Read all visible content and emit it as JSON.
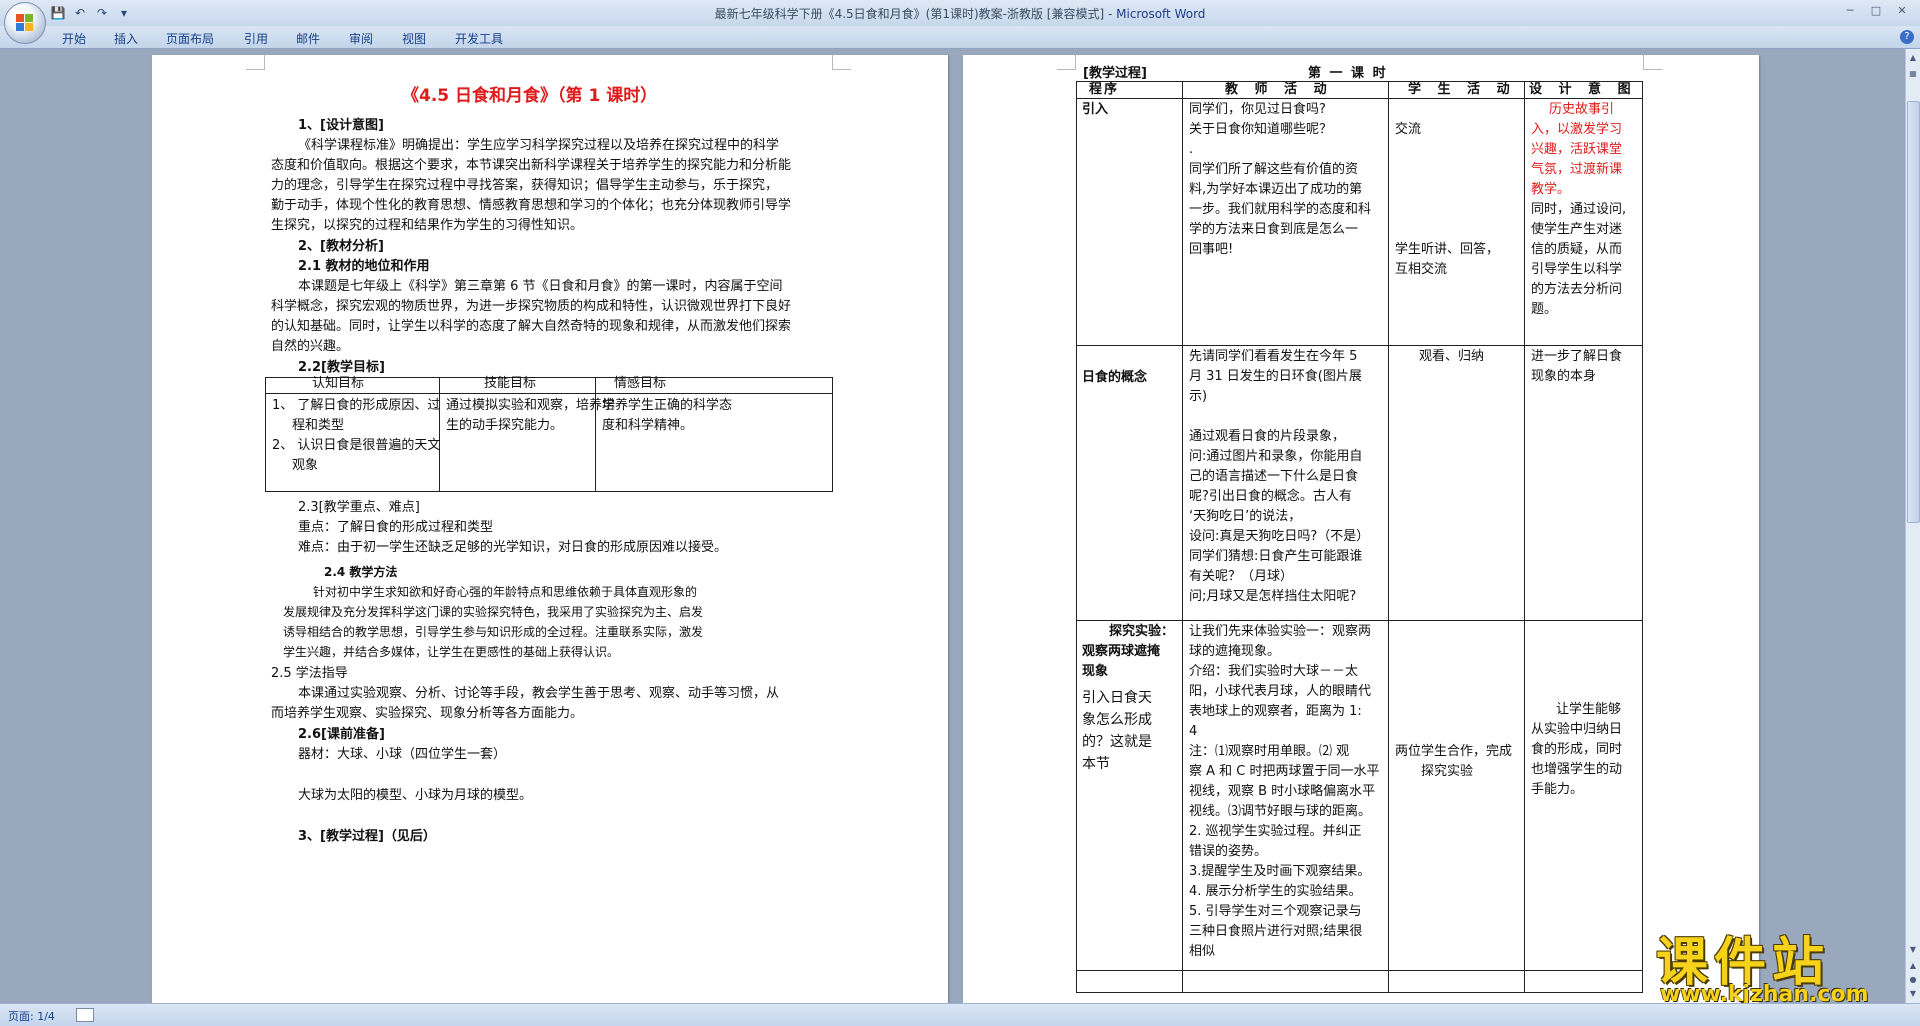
{
  "window": {
    "title_doc": "最新七年级科学下册《4.5日食和月食》(第1课时)教案-浙教版 [兼容模式] - ",
    "title_app": "Microsoft Word"
  },
  "qat": {
    "save": "save-icon",
    "undo": "undo-icon",
    "redo": "redo-icon",
    "more": "▾"
  },
  "ribbon": {
    "tabs": [
      "开始",
      "插入",
      "页面布局",
      "引用",
      "邮件",
      "审阅",
      "视图",
      "开发工具"
    ]
  },
  "status": {
    "page": "页面: 1/4"
  },
  "watermark": {
    "brand": "课件站",
    "url": "www.kjzhan.com"
  },
  "page1": {
    "title": "《4.5 日食和月食》（第 1 课时）",
    "s1_head": "1、[设计意图]",
    "s1_lines": [
      "《科学课程标准》明确提出：学生应学习科学探究过程以及培养在探究过程中的科学",
      "态度和价值取向。根据这个要求，本节课突出新科学课程关于培养学生的探究能力和分析能",
      "力的理念，引导学生在探究过程中寻找答案，获得知识；倡导学生主动参与，乐于探究，",
      "勤于动手，体现个性化的教育思想、情感教育思想和学习的个体化；也充分体现教师引导学",
      "生探究，以探究的过程和结果作为学生的习得性知识。"
    ],
    "s2_head": "2、[教材分析]",
    "s21_head": "2.1 教材的地位和作用",
    "s21_lines": [
      "本课题是七年级上《科学》第三章第 6 节《日食和月食》的第一课时，内容属于空间",
      "科学概念，探究宏观的物质世界，为进一步探究物质的构成和特性，认识微观世界打下良好",
      "的认知基础。同时，让学生以科学的态度了解大自然奇特的现象和规律，从而激发他们探索",
      "自然的兴趣。"
    ],
    "s22_head": "2.2[教学目标]",
    "goals_headers": [
      "认知目标",
      "技能目标",
      "情感目标"
    ],
    "goals_col1": [
      "1、    了解日食的形成原因、过",
      "程和类型",
      "2、    认识日食是很普遍的天文",
      "观象"
    ],
    "goals_col2": [
      "通过模拟实验和观察，培养学",
      "生的动手探究能力。"
    ],
    "goals_col3": [
      "培养学生正确的科学态",
      "度和科学精神。"
    ],
    "s23_head": "2.3[教学重点、难点]",
    "s23_key": "重点：了解日食的形成过程和类型",
    "s23_diff": "难点：由于初一学生还缺乏足够的光学知识，对日食的形成原因难以接受。",
    "s24_head": "2.4 教学方法",
    "s24_lines": [
      "针对初中学生求知欲和好奇心强的年龄特点和思维依赖于具体直观形象的",
      "发展规律及充分发挥科学这门课的实验探究特色，我采用了实验探究为主、启发",
      "诱导相结合的教学思想，引导学生参与知识形成的全过程。注重联系实际，激发",
      "学生兴趣，并结合多媒体，让学生在更感性的基础上获得认识。"
    ],
    "s25_head": "2.5 学法指导",
    "s25_lines": [
      "本课通过实验观察、分析、讨论等手段，教会学生善于思考、观察、动手等习惯，从",
      "而培养学生观察、实验探究、现象分析等各方面能力。"
    ],
    "s26_head": "2.6[课前准备]",
    "s26_tools": "器材：大球、小球（四位学生一套）",
    "s26_model": "大球为太阳的模型、小球为月球的模型。",
    "s3_head": "3、[教学过程]（见后）"
  },
  "page2": {
    "section_label": "[教学过程]",
    "lesson_label": "第 一 课 时",
    "headers": [
      "程序",
      "教 师 活 动",
      "学 生 活 动",
      "设 计 意 图"
    ],
    "row1": {
      "step": "引入",
      "teacher": [
        "同学们，你见过日食吗?",
        "关于日食你知道哪些呢？",
        ".",
        "同学们所了解这些有价值的资",
        "料,为学好本课迈出了成功的第",
        "一步。我们就用科学的态度和科",
        "学的方法来日食到底是怎么一",
        "回事吧!"
      ],
      "student": [
        "交流",
        "学生听讲、回答，",
        "互相交流"
      ],
      "design_red": [
        "历史故事引",
        "入，以激发学习",
        "兴趣，活跃课堂",
        "气氛，过渡新课",
        "教学。"
      ],
      "design": [
        "同时，通过设问,",
        "使学生产生对迷",
        "信的质疑，从而",
        "引导学生以科学",
        "的方法去分析问",
        "题。"
      ]
    },
    "row2": {
      "step": "日食的概念",
      "teacher": [
        "先请同学们看看发生在今年 5",
        "月 31 日发生的日环食(图片展",
        "示)",
        "通过观看日食的片段录象，",
        "问:通过图片和录象，你能用自",
        "己的语言描述一下什么是日食",
        "呢?引出日食的概念。古人有",
        "‘天狗吃日’的说法，",
        "设问:真是天狗吃日吗?（不是）",
        "同学们猜想:日食产生可能跟谁",
        "有关呢？（月球）",
        "问;月球又是怎样挡住太阳呢?"
      ],
      "student": [
        "观看、归纳"
      ],
      "design": [
        "进一步了解日食",
        "现象的本身"
      ]
    },
    "row3": {
      "step": [
        "探究实验：",
        "观察两球遮掩",
        "现象"
      ],
      "step_note": [
        "引入日食天",
        "象怎么形成",
        "的？这就是",
        "本节"
      ],
      "teacher": [
        "让我们先来体验实验一：观察两",
        "球的遮掩现象。",
        "介绍：我们实验时大球－－太",
        "阳，小球代表月球，人的眼睛代",
        "表地球上的观察者，距离为 1:",
        "4",
        "注：⑴观察时用单眼。⑵ 观",
        "察 A 和 C 时把两球置于同一水平",
        "视线，观察 B 时小球略偏离水平",
        "视线。⑶调节好眼与球的距离。",
        "2. 巡视学生实验过程。并纠正",
        "错误的姿势。",
        "3.提醒学生及时画下观察结果。",
        "4. 展示分析学生的实验结果。",
        "5. 引导学生对三个观察记录与",
        "三种日食照片进行对照;结果很",
        "相似"
      ],
      "student": [
        "两位学生合作，完成",
        "探究实验"
      ],
      "design": [
        "让学生能够",
        "从实验中归纳日",
        "食的形成，同时",
        "也增强学生的动",
        "手能力。"
      ]
    }
  }
}
